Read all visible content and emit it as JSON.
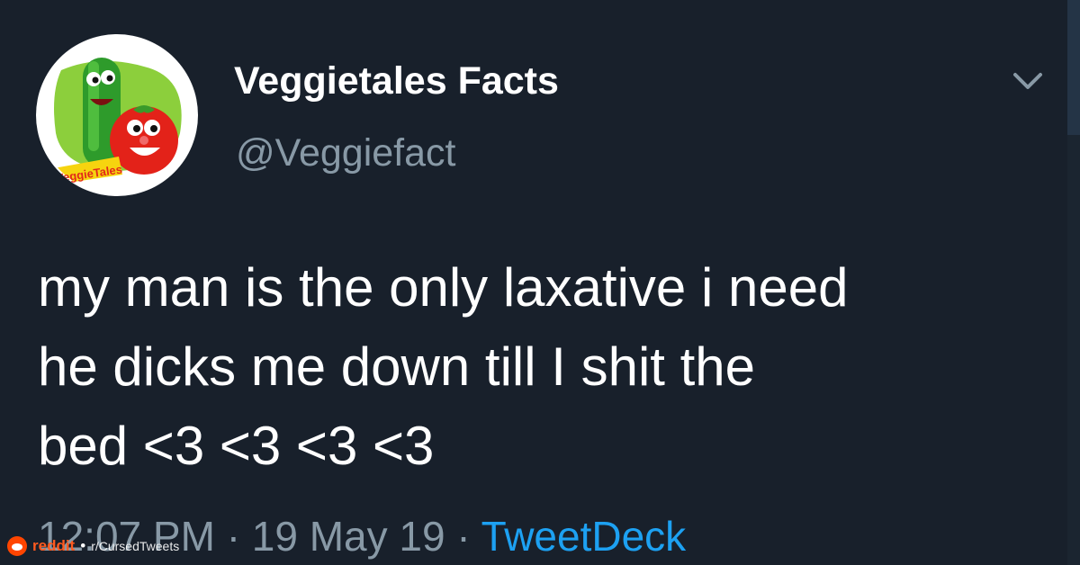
{
  "tweet": {
    "display_name": "Veggietales Facts",
    "handle": "@Veggiefact",
    "text_lines": [
      "my man is the only laxative i need",
      "he dicks me down till I shit the",
      "bed <3 <3 <3 <3"
    ],
    "time": "12:07 PM",
    "separator": "·",
    "date": "19 May 19",
    "source": "TweetDeck"
  },
  "avatar": {
    "logo_text": "VeggieTales",
    "characters": [
      "cucumber",
      "tomato"
    ]
  },
  "watermark": {
    "brand": "reddit",
    "dot": "•",
    "subreddit": "r/CursedTweets"
  },
  "colors": {
    "background": "#18202b",
    "primary_text": "#ffffff",
    "secondary_text": "#8899a6",
    "link": "#1da1f2",
    "reddit_orange": "#ff4500"
  },
  "icons": {
    "menu": "chevron-down-icon",
    "watermark": "reddit-icon"
  }
}
